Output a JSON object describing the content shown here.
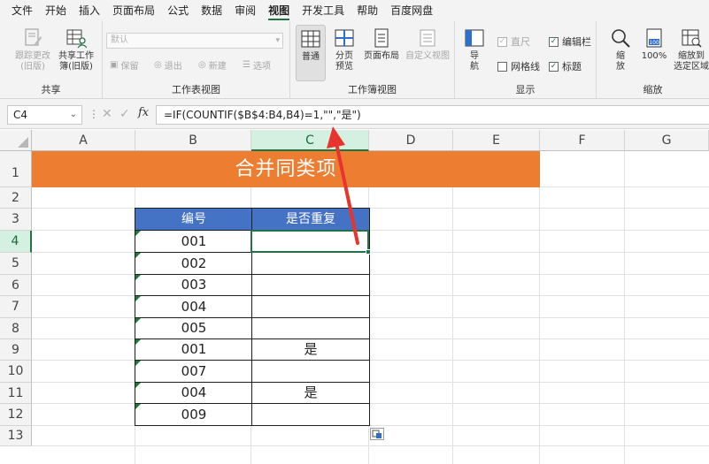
{
  "menu": {
    "items": [
      "文件",
      "开始",
      "插入",
      "页面布局",
      "公式",
      "数据",
      "审阅",
      "视图",
      "开发工具",
      "帮助",
      "百度网盘"
    ],
    "active_index": 7
  },
  "ribbon": {
    "share_group": {
      "label": "共享",
      "track_changes": "跟踪更改\n(旧版)",
      "share_workbook": "共享工作\n簿(旧版)"
    },
    "sheet_view_group": {
      "label": "工作表视图",
      "view_select_value": "默认",
      "keep": "保留",
      "exit": "退出",
      "new": "新建",
      "options": "选项"
    },
    "workbook_view_group": {
      "label": "工作簿视图",
      "normal": "普通",
      "page_break_preview": "分页\n预览",
      "page_layout": "页面布局",
      "custom_views": "自定义视图"
    },
    "show_group": {
      "label": "显示",
      "navigation": "导\n航",
      "ruler": "直尺",
      "gridlines": "网格线",
      "formula_bar": "编辑栏",
      "headings": "标题",
      "ruler_checked": true,
      "gridlines_checked": false,
      "formula_bar_checked": true,
      "headings_checked": true
    },
    "zoom_group": {
      "label": "缩放",
      "zoom": "缩\n放",
      "zoom_100": "100%",
      "zoom_to_selection": "缩放到\n选定区域"
    }
  },
  "formula_bar": {
    "name_box": "C4",
    "fx_label": "fx",
    "formula": "=IF(COUNTIF($B$4:B4,B4)=1,\"\",\"是\")"
  },
  "sheet": {
    "columns": [
      "A",
      "B",
      "C",
      "D",
      "E",
      "F",
      "G"
    ],
    "rows": [
      "1",
      "2",
      "3",
      "4",
      "5",
      "6",
      "7",
      "8",
      "9",
      "10",
      "11",
      "12",
      "13"
    ],
    "active_cell": "C4",
    "title": "合并同类项",
    "table": {
      "headers": [
        "编号",
        "是否重复"
      ],
      "rows": [
        [
          "001",
          ""
        ],
        [
          "002",
          ""
        ],
        [
          "003",
          ""
        ],
        [
          "004",
          ""
        ],
        [
          "005",
          ""
        ],
        [
          "001",
          "是"
        ],
        [
          "007",
          ""
        ],
        [
          "004",
          "是"
        ],
        [
          "009",
          ""
        ]
      ]
    }
  },
  "colors": {
    "accent_green": "#217346",
    "title_fill": "#ed7d31",
    "table_header_fill": "#4472c4",
    "annotation_arrow": "#e8342f"
  }
}
